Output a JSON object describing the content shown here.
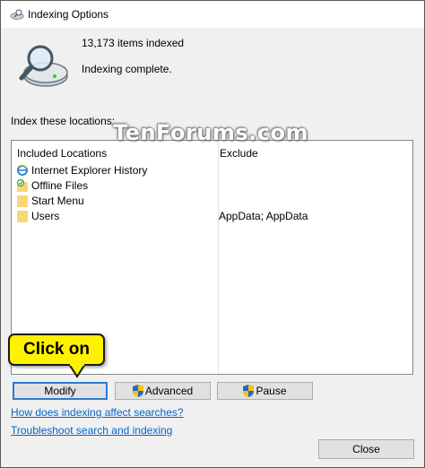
{
  "window": {
    "title": "Indexing Options"
  },
  "status": {
    "items_indexed": "13,173 items indexed",
    "state": "Indexing complete."
  },
  "locations": {
    "section_label": "Index these locations:",
    "col_included": "Included Locations",
    "col_exclude": "Exclude",
    "rows": [
      {
        "name": "Internet Explorer History",
        "exclude": "",
        "icon": "ie-icon"
      },
      {
        "name": "Offline Files",
        "exclude": "",
        "icon": "offline-files-icon"
      },
      {
        "name": "Start Menu",
        "exclude": "",
        "icon": "folder-icon"
      },
      {
        "name": "Users",
        "exclude": "AppData; AppData",
        "icon": "folder-icon"
      }
    ]
  },
  "watermark": "TenForums.com",
  "callout": {
    "text": "Click on",
    "color": "#fff200"
  },
  "buttons": {
    "modify": "Modify",
    "advanced": "Advanced",
    "pause": "Pause",
    "close": "Close"
  },
  "links": {
    "how_affects": "How does indexing affect searches?",
    "troubleshoot": "Troubleshoot search and indexing"
  },
  "colors": {
    "link": "#0066cc",
    "focus_border": "#2a7bd6",
    "folder": "#f8d775"
  }
}
